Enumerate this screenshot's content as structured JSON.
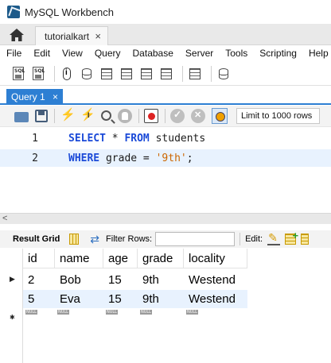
{
  "window": {
    "title": "MySQL Workbench"
  },
  "connection_tab": {
    "label": "tutorialkart",
    "close": "×"
  },
  "menu": [
    "File",
    "Edit",
    "View",
    "Query",
    "Database",
    "Server",
    "Tools",
    "Scripting",
    "Help"
  ],
  "query_tab": {
    "label": "Query 1",
    "close": "×"
  },
  "sql_toolbar": {
    "limit_label": "Limit to 1000 rows"
  },
  "editor": {
    "lines": [
      {
        "num": "1",
        "tokens": [
          {
            "t": "SELECT",
            "k": "kw"
          },
          {
            "t": " * ",
            "k": "plain"
          },
          {
            "t": "FROM",
            "k": "kw"
          },
          {
            "t": " students",
            "k": "plain"
          }
        ]
      },
      {
        "num": "2",
        "tokens": [
          {
            "t": "WHERE",
            "k": "kw"
          },
          {
            "t": " grade = ",
            "k": "plain"
          },
          {
            "t": "'9th'",
            "k": "str"
          },
          {
            "t": ";",
            "k": "plain"
          }
        ]
      }
    ]
  },
  "result_toolbar": {
    "result_grid_label": "Result Grid",
    "filter_label": "Filter Rows:",
    "filter_value": "",
    "edit_label": "Edit:"
  },
  "result_grid": {
    "columns": [
      "id",
      "name",
      "age",
      "grade",
      "locality"
    ],
    "rows": [
      [
        "2",
        "Bob",
        "15",
        "9th",
        "Westend"
      ],
      [
        "5",
        "Eva",
        "15",
        "9th",
        "Westend"
      ]
    ],
    "new_row_placeholder": "NULL",
    "selected_row_marker": "▶",
    "new_row_marker": "✱"
  },
  "colors": {
    "accent": "#2d7fd3",
    "keyword": "#1b4ad8",
    "string": "#cc6600",
    "current_line": "#e8f2fe",
    "alt_row": "#e8f2fe"
  }
}
